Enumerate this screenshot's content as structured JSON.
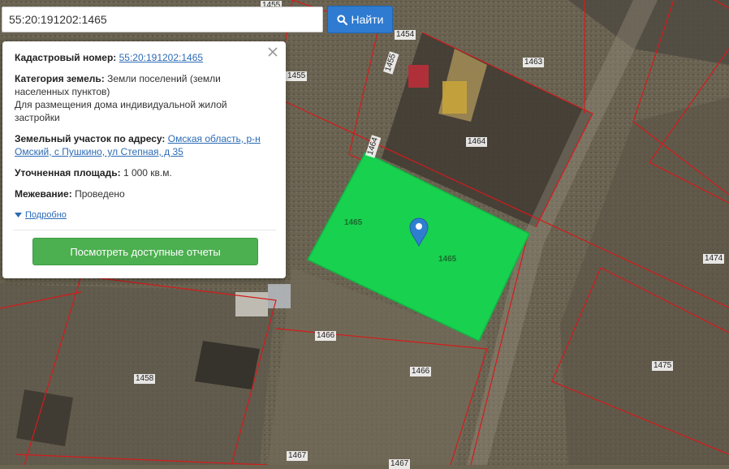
{
  "search": {
    "value": "55:20:191202:1465",
    "button_label": "Найти",
    "button_icon": "search-icon"
  },
  "popup": {
    "cadastral_label": "Кадастровый номер:",
    "cadastral_value": "55:20:191202:1465",
    "category_label": "Категория земель:",
    "category_value": "Земли поселений (земли населенных пунктов)",
    "purpose": "Для размещения дома индивидуальной жилой застройки",
    "address_label": "Земельный участок по адресу:",
    "address_value": "Омская область, р-н Омский, с Пушкино, ул Степная, д 35",
    "area_label": "Уточненная площадь:",
    "area_value": "1 000 кв.м.",
    "survey_label": "Межевание:",
    "survey_value": "Проведено",
    "more_label": "Подробно",
    "reports_button": "Посмотреть доступные отчеты"
  },
  "map": {
    "plots": [
      "1455",
      "1454",
      "1455",
      "1463",
      "1464",
      "1464",
      "1465",
      "1465",
      "1466",
      "1466",
      "1458",
      "1474",
      "1475",
      "1467",
      "1467"
    ]
  },
  "colors": {
    "accent": "#2e7bd1",
    "selected_plot": "#18d14f",
    "boundary": "#d61a1a",
    "cta": "#4caf50"
  }
}
